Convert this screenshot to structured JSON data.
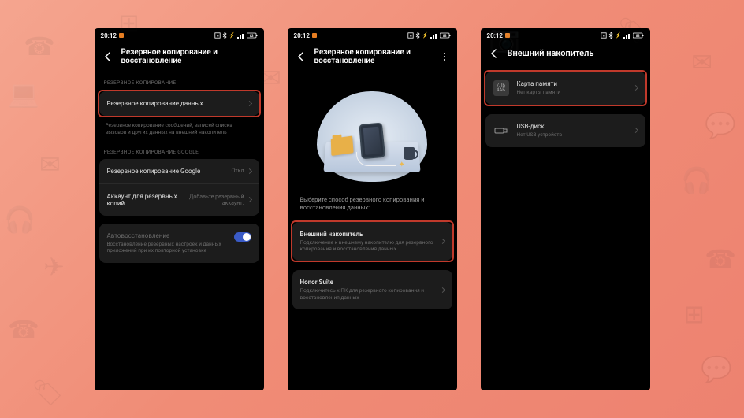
{
  "status": {
    "time": "20:12"
  },
  "screen1": {
    "title": "Резервное копирование и восстановление",
    "section1_label": "РЕЗЕРВНОЕ КОПИРОВАНИЕ",
    "backup_data": "Резервное копирование данных",
    "backup_help": "Резервное копирование сообщений, записей списка вызовов и других данных на внешний накопитель",
    "section2_label": "РЕЗЕРВНОЕ КОПИРОВАНИЕ GOOGLE",
    "google_backup": "Резервное копирование Google",
    "google_backup_value": "Откл",
    "backup_account": "Аккаунт для резервных копий",
    "backup_account_value": "Добавьте резервный аккаунт.",
    "autorestore": "Автовосстановление",
    "autorestore_sub": "Восстановление резервных настроек и данных приложений при их повторной установке"
  },
  "screen2": {
    "title": "Резервное копирование и восстановление",
    "prompt": "Выберите способ резервного копирования и восстановления данных:",
    "ext_title": "Внешний накопитель",
    "ext_sub": "Подключение к внешнему накопителю для резервного копирования и восстановления данных",
    "honor_title": "Honor Suite",
    "honor_sub": "Подключитесь к ПК для резервного копирования и восстановления данных"
  },
  "screen3": {
    "title": "Внешний накопитель",
    "sd_label_top": "7ЛБ",
    "sd_label_bot": "4АБ",
    "sd_title": "Карта памяти",
    "sd_sub": "Нет карты памяти",
    "usb_title": "USB-диск",
    "usb_sub": "Нет USB-устройств"
  }
}
